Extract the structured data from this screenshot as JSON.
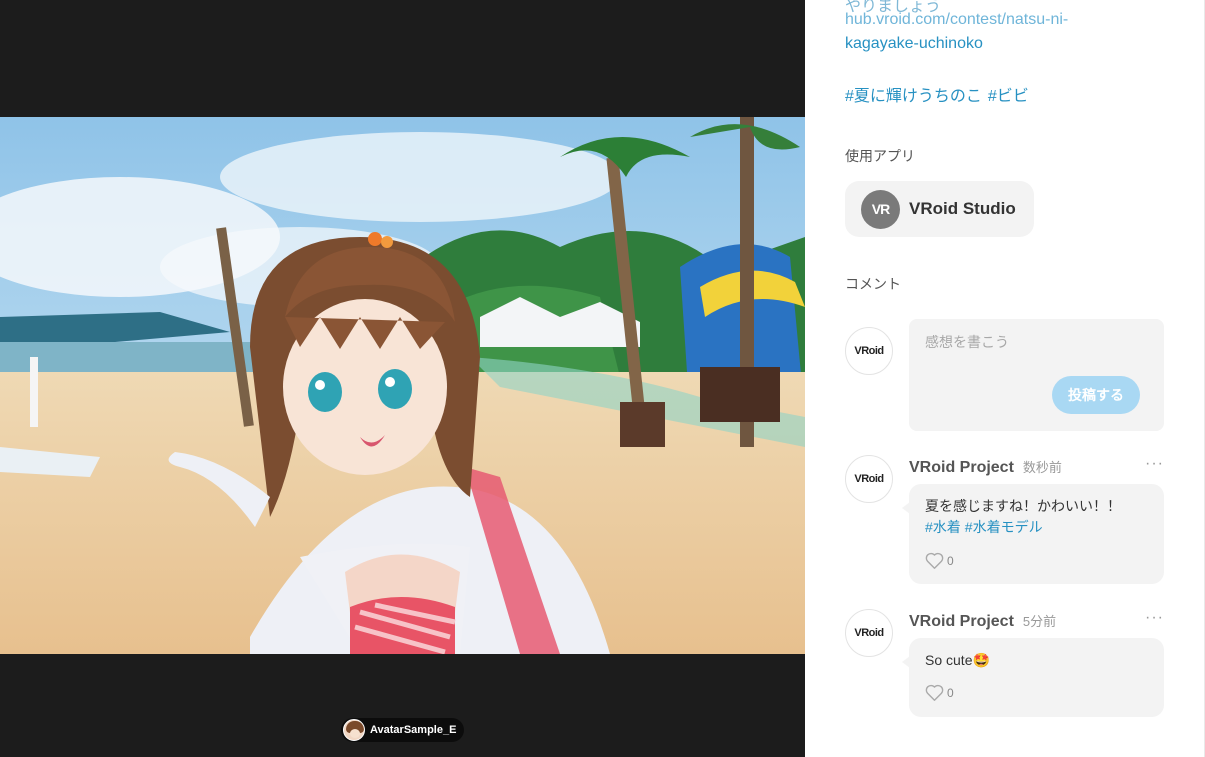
{
  "viewer": {
    "model_name": "AvatarSample_E"
  },
  "sidebar": {
    "cut_text": "やりましょう",
    "link_line1": "hub.vroid.com/contest/natsu-ni-",
    "link_line2": "kagayake-uchinoko",
    "tags": [
      "#夏に輝けうちのこ",
      "#ビビ"
    ],
    "app_section_label": "使用アプリ",
    "app": {
      "logo": "VR",
      "name": "VRoid Studio"
    },
    "comments_label": "コメント"
  },
  "compose": {
    "avatar_label": "VRoid",
    "placeholder": "感想を書こう",
    "submit_label": "投稿する"
  },
  "comments": [
    {
      "avatar_label": "VRoid",
      "author": "VRoid Project",
      "time": "数秒前",
      "text": "夏を感じますね！かわいい！！",
      "tags": [
        "#水着",
        "#水着モデル"
      ],
      "likes": "0",
      "more": "···"
    },
    {
      "avatar_label": "VRoid",
      "author": "VRoid Project",
      "time": "5分前",
      "text": "So cute🤩",
      "tags": [],
      "likes": "0",
      "more": "···"
    }
  ],
  "colors": {
    "viewer_bg": "#1c1c1c",
    "link": "#2791c2",
    "post_button": "#a9d8f3",
    "card_bg": "#f3f3f3"
  },
  "icons": {
    "like": "heart-outline-icon",
    "more": "more-horizontal-icon"
  }
}
